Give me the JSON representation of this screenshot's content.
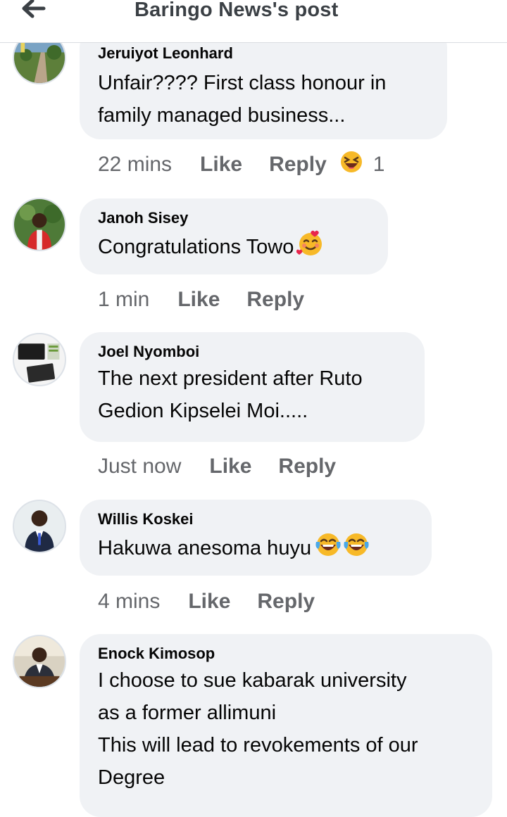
{
  "header": {
    "title": "Baringo News's post",
    "back_icon": "arrow-left-icon"
  },
  "comments": [
    {
      "author": "Jeruiyot Leonhard",
      "lines": [
        "Unfair???? First class honour in",
        "family managed business..."
      ],
      "time": "22 mins",
      "like": "Like",
      "reply": "Reply",
      "reaction": {
        "icon": "laughing-squinting-emoji-icon",
        "count": "1"
      },
      "avatar": "road-landscape-avatar"
    },
    {
      "author": "Janoh Sisey",
      "lines": [
        "Congratulations Towo"
      ],
      "emojis": [
        "smiling-face-with-hearts-emoji-icon"
      ],
      "time": "1 min",
      "like": "Like",
      "reply": "Reply",
      "avatar": "person-red-shirt-avatar"
    },
    {
      "author": "Joel Nyomboi",
      "lines": [
        "The next president after Ruto",
        "Gedion Kipselei Moi....."
      ],
      "time": "Just now",
      "like": "Like",
      "reply": "Reply",
      "avatar": "tablet-device-avatar"
    },
    {
      "author": "Willis Koskei",
      "lines": [
        "Hakuwa anesoma huyu"
      ],
      "emojis": [
        "face-with-tears-of-joy-emoji-icon",
        "face-with-tears-of-joy-emoji-icon"
      ],
      "time": "4 mins",
      "like": "Like",
      "reply": "Reply",
      "avatar": "man-suit-avatar"
    },
    {
      "author": "Enock Kimosop",
      "lines": [
        "I choose to sue kabarak university",
        "as a former allimuni",
        "This will lead to revokements of our",
        "Degree"
      ],
      "avatar": "man-desk-avatar"
    }
  ],
  "colors": {
    "bubble": "#f0f2f5",
    "meta_text": "#65676b",
    "primary_text": "#050505"
  }
}
